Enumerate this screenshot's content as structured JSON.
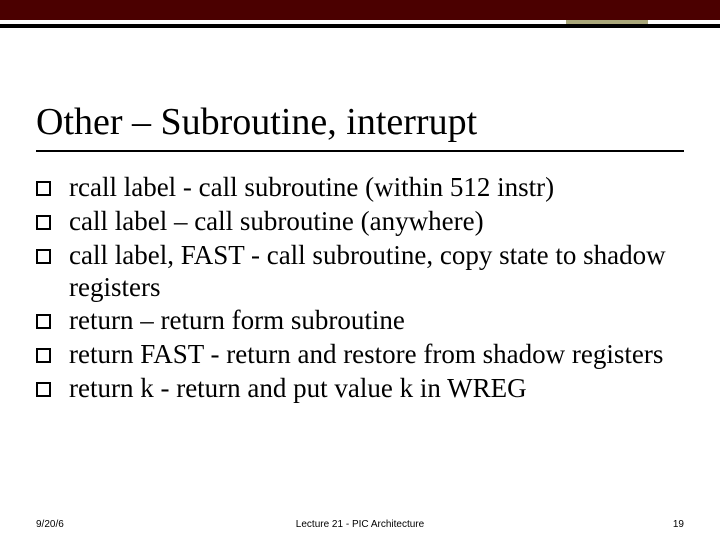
{
  "title": "Other – Subroutine, interrupt",
  "bullets": [
    "rcall label  - call subroutine (within 512 instr)",
    "call label – call subroutine (anywhere)",
    "call  label, FAST  - call subroutine, copy state to shadow registers",
    "return – return form subroutine",
    "return  FAST  - return and restore from shadow registers",
    "return  k  - return and put value k in WREG"
  ],
  "footer": {
    "date": "9/20/6",
    "center": "Lecture 21 - PIC Architecture",
    "page": "19"
  }
}
